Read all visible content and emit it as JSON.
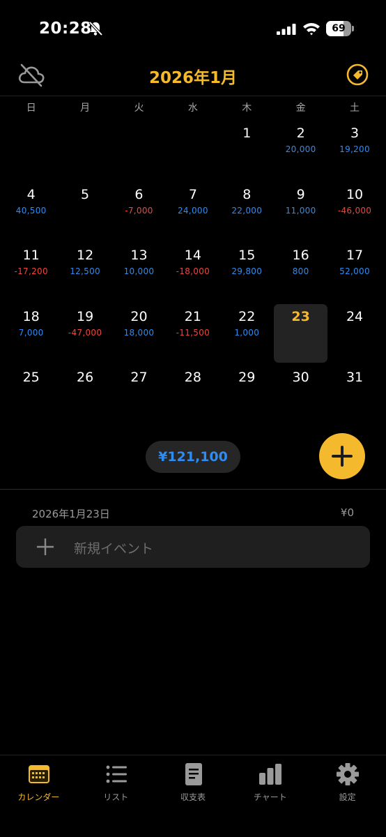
{
  "status_bar": {
    "time": "20:28",
    "battery": "69",
    "battery_level": 0.69
  },
  "header": {
    "title": "2026年1月"
  },
  "weekdays": [
    "日",
    "月",
    "火",
    "水",
    "木",
    "金",
    "土"
  ],
  "calendar": {
    "weeks": [
      [
        {
          "day": "",
          "amount": "",
          "sign": ""
        },
        {
          "day": "",
          "amount": "",
          "sign": ""
        },
        {
          "day": "",
          "amount": "",
          "sign": ""
        },
        {
          "day": "",
          "amount": "",
          "sign": ""
        },
        {
          "day": "1",
          "amount": "",
          "sign": ""
        },
        {
          "day": "2",
          "amount": "20,000",
          "sign": "pos"
        },
        {
          "day": "3",
          "amount": "19,200",
          "sign": "pos"
        }
      ],
      [
        {
          "day": "4",
          "amount": "40,500",
          "sign": "pos"
        },
        {
          "day": "5",
          "amount": "",
          "sign": ""
        },
        {
          "day": "6",
          "amount": "-7,000",
          "sign": "neg"
        },
        {
          "day": "7",
          "amount": "24,000",
          "sign": "pos"
        },
        {
          "day": "8",
          "amount": "22,000",
          "sign": "pos"
        },
        {
          "day": "9",
          "amount": "11,000",
          "sign": "pos"
        },
        {
          "day": "10",
          "amount": "-46,000",
          "sign": "neg"
        }
      ],
      [
        {
          "day": "11",
          "amount": "-17,200",
          "sign": "neg"
        },
        {
          "day": "12",
          "amount": "12,500",
          "sign": "pos"
        },
        {
          "day": "13",
          "amount": "10,000",
          "sign": "pos"
        },
        {
          "day": "14",
          "amount": "-18,000",
          "sign": "neg"
        },
        {
          "day": "15",
          "amount": "29,800",
          "sign": "pos"
        },
        {
          "day": "16",
          "amount": "800",
          "sign": "pos"
        },
        {
          "day": "17",
          "amount": "52,000",
          "sign": "pos"
        }
      ],
      [
        {
          "day": "18",
          "amount": "7,000",
          "sign": "pos"
        },
        {
          "day": "19",
          "amount": "-47,000",
          "sign": "neg"
        },
        {
          "day": "20",
          "amount": "18,000",
          "sign": "pos"
        },
        {
          "day": "21",
          "amount": "-11,500",
          "sign": "neg"
        },
        {
          "day": "22",
          "amount": "1,000",
          "sign": "pos"
        },
        {
          "day": "23",
          "amount": "",
          "sign": "",
          "today": true
        },
        {
          "day": "24",
          "amount": "",
          "sign": ""
        }
      ],
      [
        {
          "day": "25",
          "amount": "",
          "sign": ""
        },
        {
          "day": "26",
          "amount": "",
          "sign": ""
        },
        {
          "day": "27",
          "amount": "",
          "sign": ""
        },
        {
          "day": "28",
          "amount": "",
          "sign": ""
        },
        {
          "day": "29",
          "amount": "",
          "sign": ""
        },
        {
          "day": "30",
          "amount": "",
          "sign": ""
        },
        {
          "day": "31",
          "amount": "",
          "sign": ""
        }
      ]
    ]
  },
  "summary": {
    "total": "¥121,100"
  },
  "selected_day": {
    "date": "2026年1月23日",
    "total": "¥0",
    "new_event_placeholder": "新規イベント"
  },
  "tabs": [
    {
      "label": "カレンダー",
      "icon": "calendar-icon",
      "active": true
    },
    {
      "label": "リスト",
      "icon": "list-icon",
      "active": false
    },
    {
      "label": "収支表",
      "icon": "document-icon",
      "active": false
    },
    {
      "label": "チャート",
      "icon": "bar-chart-icon",
      "active": false
    },
    {
      "label": "設定",
      "icon": "gear-icon",
      "active": false
    }
  ],
  "colors": {
    "accent": "#f5b92e",
    "positive": "#2f8cf0",
    "negative": "#f0463c",
    "background": "#000000"
  }
}
